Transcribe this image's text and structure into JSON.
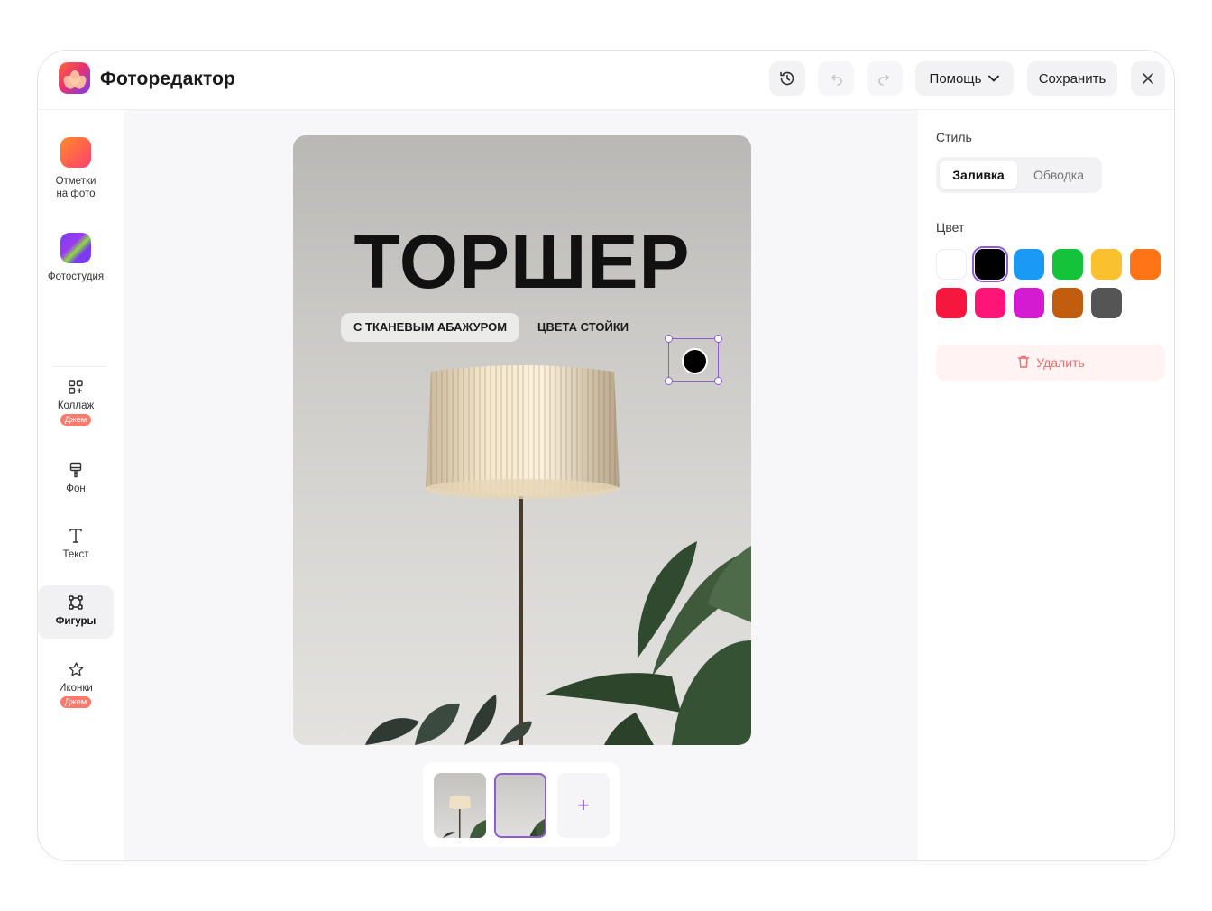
{
  "app": {
    "title": "Фоторедактор"
  },
  "header": {
    "history_icon": "history-icon",
    "undo_icon": "undo-icon",
    "redo_icon": "redo-icon",
    "help_label": "Помощь",
    "save_label": "Сохранить",
    "close_icon": "close-icon"
  },
  "sidebar": {
    "items": [
      {
        "label": "Отметки\nна фото",
        "icon": "photo-marks-icon"
      },
      {
        "label": "Фотостудия",
        "icon": "photo-studio-icon"
      },
      {
        "label": "Коллаж",
        "icon": "collage-icon",
        "badge": "Джем"
      },
      {
        "label": "Фон",
        "icon": "background-brush-icon"
      },
      {
        "label": "Текст",
        "icon": "text-icon"
      },
      {
        "label": "Фигуры",
        "icon": "shapes-icon",
        "active": true
      },
      {
        "label": "Иконки",
        "icon": "star-icon",
        "badge": "Джем"
      }
    ]
  },
  "canvas": {
    "headline": "ТОРШЕР",
    "chip_1": "С ТКАНЕВЫМ АБАЖУРОМ",
    "chip_2": "ЦВЕТА СТОЙКИ"
  },
  "thumbnails": {
    "add_label": "+"
  },
  "panel": {
    "style_label": "Стиль",
    "style_options": [
      "Заливка",
      "Обводка"
    ],
    "style_selected": "Заливка",
    "color_label": "Цвет",
    "colors": [
      "#ffffff",
      "#000000",
      "#1a9af5",
      "#13c33a",
      "#fbc02d",
      "#ff7417",
      "#f5173e",
      "#ff1478",
      "#d41bd2",
      "#c25d10",
      "#555555"
    ],
    "selected_color": "#000000",
    "delete_label": "Удалить"
  },
  "accent_color": "#8f5bd6"
}
